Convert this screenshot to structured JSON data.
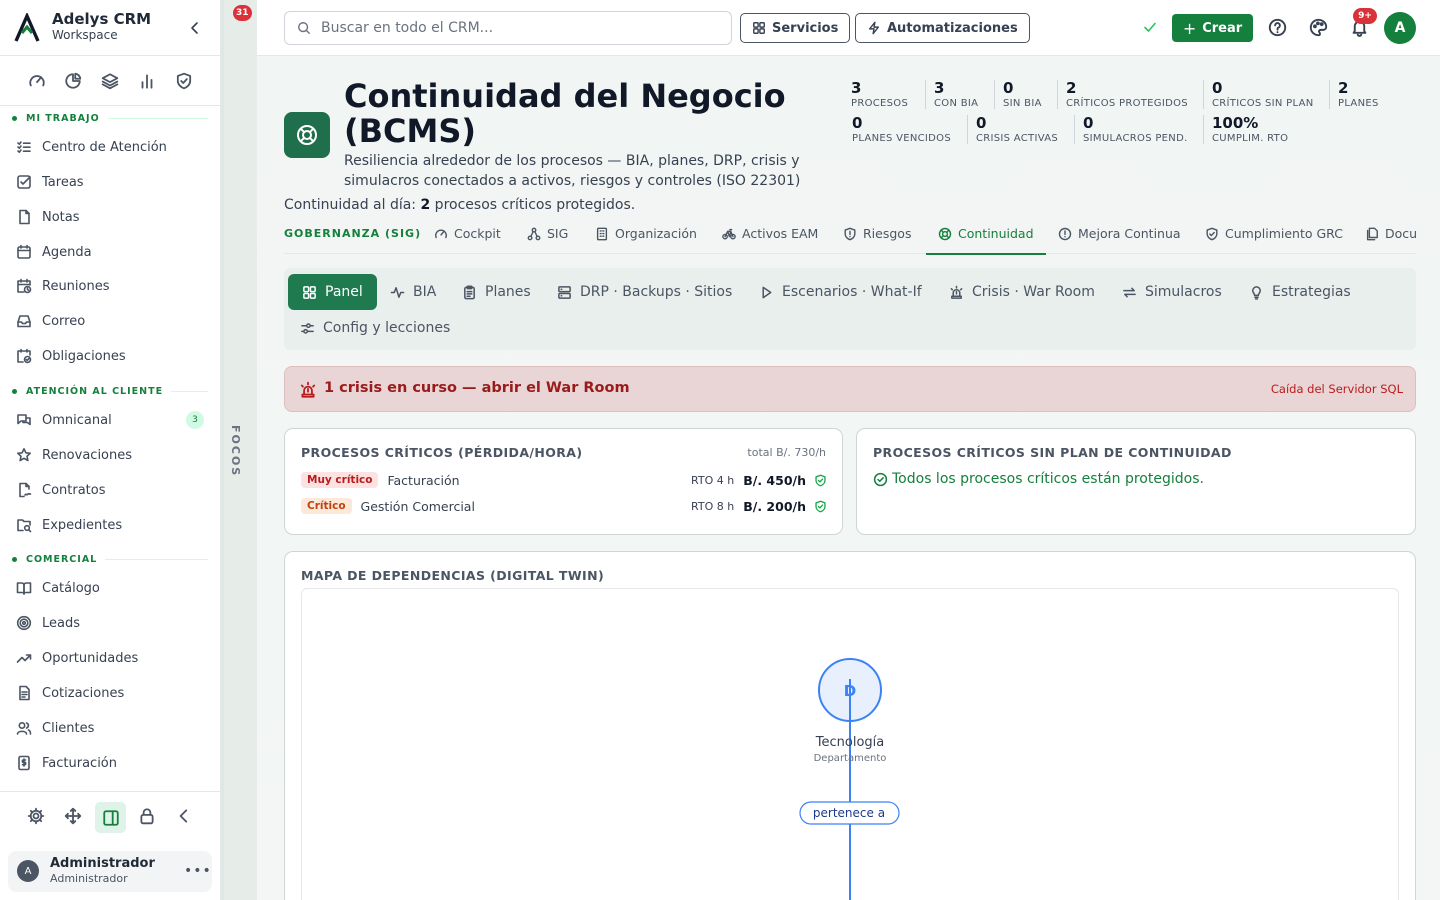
{
  "sidebar": {
    "brand": {
      "name": "Adelys CRM",
      "sub": "Workspace"
    },
    "quick_icons": [
      "gauge-icon",
      "chart-ring-icon",
      "layers-icon",
      "bar-chart-icon",
      "shield-check-icon"
    ],
    "sections": [
      {
        "title": "MI TRABAJO",
        "items": [
          {
            "label": "Centro de Atención",
            "icon": "list-checks-icon"
          },
          {
            "label": "Tareas",
            "icon": "checkbox-icon"
          },
          {
            "label": "Notas",
            "icon": "file-icon"
          },
          {
            "label": "Agenda",
            "icon": "calendar-icon"
          },
          {
            "label": "Reuniones",
            "icon": "calendar-clock-icon"
          },
          {
            "label": "Correo",
            "icon": "inbox-icon"
          },
          {
            "label": "Obligaciones",
            "icon": "calendar-check-icon"
          }
        ]
      },
      {
        "title": "ATENCIÓN AL CLIENTE",
        "items": [
          {
            "label": "Omnicanal",
            "icon": "messages-icon",
            "count": "3"
          },
          {
            "label": "Renovaciones",
            "icon": "star-icon"
          },
          {
            "label": "Contratos",
            "icon": "file-signature-icon"
          },
          {
            "label": "Expedientes",
            "icon": "folder-search-icon"
          }
        ]
      },
      {
        "title": "COMERCIAL",
        "items": [
          {
            "label": "Catálogo",
            "icon": "book-icon"
          },
          {
            "label": "Leads",
            "icon": "target-icon"
          },
          {
            "label": "Oportunidades",
            "icon": "trending-up-icon"
          },
          {
            "label": "Cotizaciones",
            "icon": "document-icon"
          },
          {
            "label": "Clientes",
            "icon": "users-icon"
          },
          {
            "label": "Facturación",
            "icon": "receipt-icon"
          }
        ]
      }
    ],
    "footer_icons": [
      "settings-icon",
      "move-icon",
      "panel-icon",
      "lock-icon",
      "chevron-left-icon"
    ],
    "user": {
      "initial": "A",
      "name": "Administrador",
      "role": "Administrador"
    }
  },
  "focos": {
    "badge": "31",
    "label": "FOCOS"
  },
  "topbar": {
    "search_placeholder": "Buscar en todo el CRM...",
    "services": "Servicios",
    "automations": "Automatizaciones",
    "create": "Crear",
    "notif_badge": "9+",
    "avatar": "A"
  },
  "header": {
    "title": "Continuidad del Negocio (BCMS)",
    "description": "Resiliencia alrededor de los procesos — BIA, planes, DRP, crisis y simulacros conectados a activos, riesgos y controles (ISO 22301)",
    "day_prefix": "Continuidad al día: ",
    "day_count": "2",
    "day_suffix": " procesos críticos protegidos.",
    "stats": [
      {
        "value": "3",
        "label": "PROCESOS"
      },
      {
        "value": "3",
        "label": "CON BIA"
      },
      {
        "value": "0",
        "label": "SIN BIA"
      },
      {
        "value": "2",
        "label": "CRÍTICOS PROTEGIDOS"
      },
      {
        "value": "0",
        "label": "CRÍTICOS SIN PLAN"
      },
      {
        "value": "2",
        "label": "PLANES"
      },
      {
        "value": "0",
        "label": "PLANES VENCIDOS"
      },
      {
        "value": "0",
        "label": "CRISIS ACTIVAS"
      },
      {
        "value": "0",
        "label": "SIMULACROS PEND."
      },
      {
        "value": "100%",
        "label": "CUMPLIM. RTO"
      }
    ]
  },
  "tabs": {
    "group": "GOBERNANZA (SIG)",
    "items": [
      {
        "label": "Cockpit",
        "icon": "gauge-icon"
      },
      {
        "label": "SIG",
        "icon": "network-icon"
      },
      {
        "label": "Organización",
        "icon": "building-icon"
      },
      {
        "label": "Activos EAM",
        "icon": "bike-icon"
      },
      {
        "label": "Riesgos",
        "icon": "shield-alert-icon"
      },
      {
        "label": "Continuidad",
        "icon": "life-buoy-icon"
      },
      {
        "label": "Mejora Continua",
        "icon": "alert-circle-icon"
      },
      {
        "label": "Cumplimiento GRC",
        "icon": "shield-check-icon"
      },
      {
        "label": "Docu",
        "icon": "documents-icon"
      }
    ],
    "active": "Continuidad"
  },
  "subtabs": [
    {
      "label": "Panel",
      "icon": "grid-icon"
    },
    {
      "label": "BIA",
      "icon": "activity-icon"
    },
    {
      "label": "Planes",
      "icon": "clipboard-icon"
    },
    {
      "label": "DRP · Backups · Sitios",
      "icon": "server-icon"
    },
    {
      "label": "Escenarios · What-If",
      "icon": "play-icon"
    },
    {
      "label": "Crisis · War Room",
      "icon": "siren-icon"
    },
    {
      "label": "Simulacros",
      "icon": "repeat-icon"
    },
    {
      "label": "Estrategias",
      "icon": "lightbulb-icon"
    },
    {
      "label": "Config y lecciones",
      "icon": "sliders-icon"
    }
  ],
  "alert": {
    "text": "1 crisis en curso — abrir el War Room",
    "link": "Caída del Servidor SQL"
  },
  "critical_processes": {
    "title": "PROCESOS CRÍTICOS (PÉRDIDA/HORA)",
    "total": "total B/. 730/h",
    "rows": [
      {
        "tag": "Muy crítico",
        "name": "Facturación",
        "rto": "RTO 4 h",
        "loss": "B/. 450/h"
      },
      {
        "tag": "Crítico",
        "name": "Gestión Comercial",
        "rto": "RTO 8 h",
        "loss": "B/. 200/h"
      }
    ]
  },
  "no_plan": {
    "title": "PROCESOS CRÍTICOS SIN PLAN DE CONTINUIDAD",
    "message": "Todos los procesos críticos están protegidos."
  },
  "dependency_map": {
    "title": "MAPA DE DEPENDENCIAS (DIGITAL TWIN)",
    "node": {
      "initial": "D",
      "name": "Tecnología",
      "type": "Departamento"
    },
    "edge_label": "pertenece a"
  },
  "colors": {
    "brand": "#15803d",
    "danger": "#d9323a",
    "map_node": "#3b82f6"
  }
}
